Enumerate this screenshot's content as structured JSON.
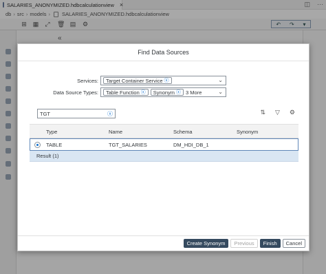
{
  "editor": {
    "tab_title": "SALARIES_ANONYMIZED.hdbcalculationview",
    "breadcrumb": [
      "db",
      "src",
      "models",
      "SALARIES_ANONYMIZED.hdbcalculationview"
    ]
  },
  "dialog": {
    "title": "Find Data Sources",
    "services": {
      "label": "Services:",
      "tokens": [
        "Target Container Service"
      ]
    },
    "data_source_types": {
      "label": "Data Source Types:",
      "tokens": [
        "Table Function",
        "Synonym"
      ],
      "more": "3 More"
    },
    "search": {
      "value": "TGT"
    },
    "table": {
      "columns": [
        "Type",
        "Name",
        "Schema",
        "Synonym"
      ],
      "rows": [
        {
          "type": "TABLE",
          "name": "TGT_SALARIES",
          "schema": "DM_HDI_DB_1",
          "synonym": ""
        }
      ],
      "result_label": "Result (1)"
    },
    "buttons": {
      "create_synonym": "Create Synonym",
      "previous": "Previous",
      "finish": "Finish",
      "cancel": "Cancel"
    }
  }
}
